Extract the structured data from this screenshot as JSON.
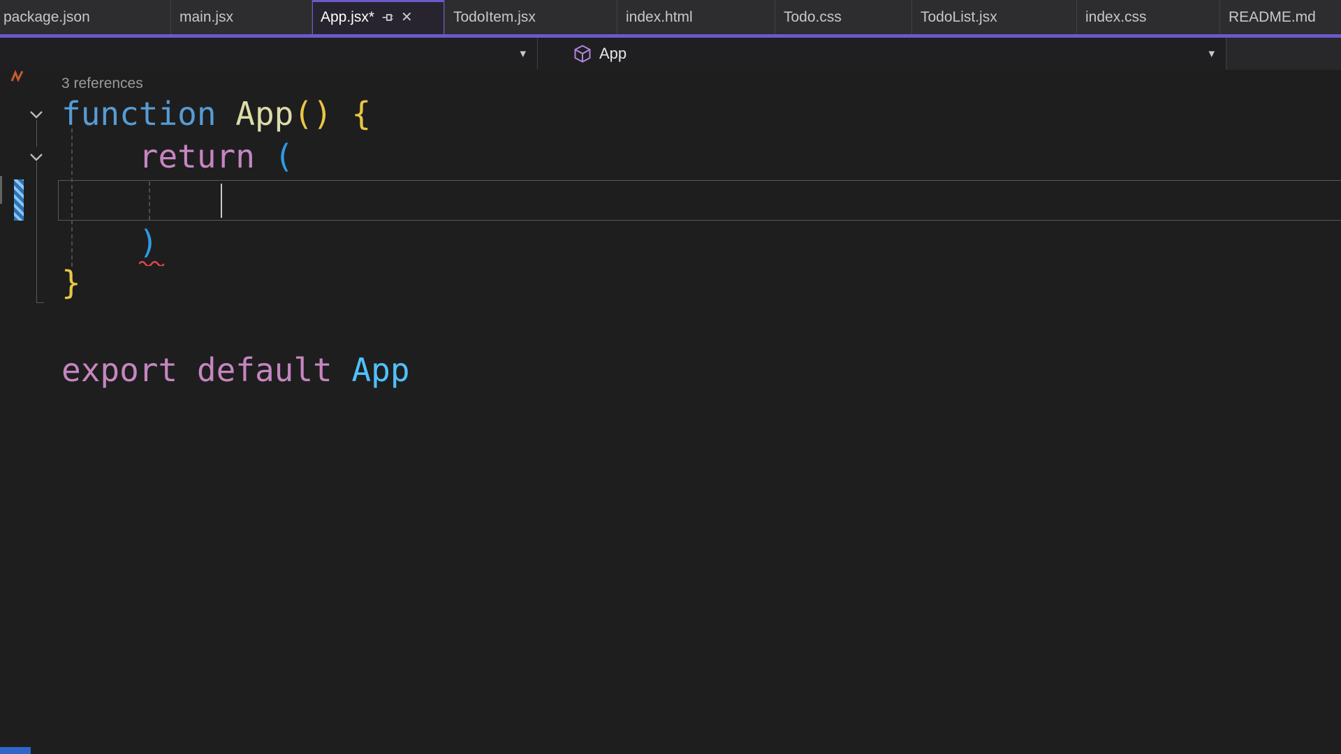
{
  "ui_colors": {
    "accent_purple": "#6A5BCB",
    "editor_background": "#1E1E1E",
    "keyword_blue": "#569CD6",
    "keyword_pink": "#C586C0",
    "function_name_yellow": "#DCDCAA",
    "bracket_gold": "#EAC645",
    "bracket_blue": "#2E9BE6",
    "identifier_blue": "#4FC1FF",
    "squiggle_red": "#E5484D",
    "change_bar_blue": "#2D74B5"
  },
  "tab_bar": {
    "active_tab": "App.jsx*",
    "close_icon": "✕",
    "tabs": [
      {
        "label": "package.json"
      },
      {
        "label": "main.jsx"
      },
      {
        "label": "App.jsx*"
      },
      {
        "label": "TodoItem.jsx"
      },
      {
        "label": "index.html"
      },
      {
        "label": "Todo.css"
      },
      {
        "label": "TodoList.jsx"
      },
      {
        "label": "index.css"
      },
      {
        "label": "README.md"
      }
    ]
  },
  "nav_bar": {
    "scope_label": "App",
    "dropdown_arrow": "▾"
  },
  "editor": {
    "codelens": "3 references",
    "code": {
      "l1": {
        "kw": "function",
        "sp1": " ",
        "name": "App",
        "parens": "()",
        "sp2": " ",
        "brace": "{"
      },
      "l2": {
        "indent": "    ",
        "kw": "return",
        "sp": " ",
        "paren": "("
      },
      "l4": {
        "indent": "    ",
        "paren": ")"
      },
      "l5": {
        "brace": "}"
      },
      "l7": {
        "kw1": "export",
        "sp1": " ",
        "kw2": "default",
        "sp2": " ",
        "name": "App"
      }
    }
  }
}
